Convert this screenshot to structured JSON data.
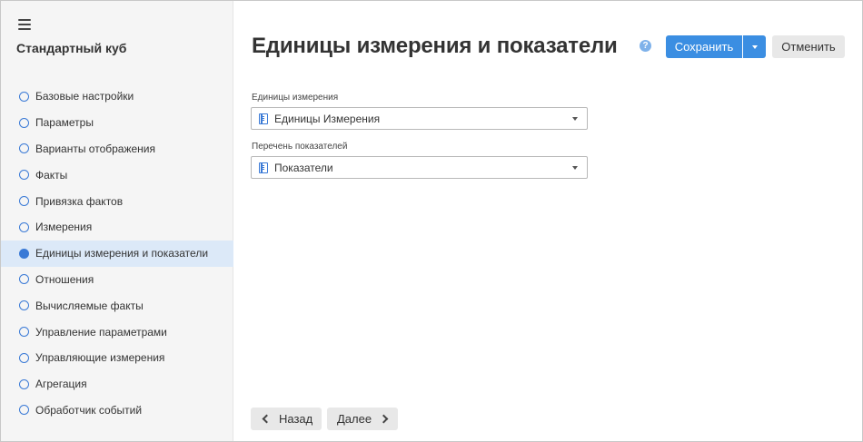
{
  "sidebar": {
    "title": "Стандартный куб",
    "steps": [
      {
        "label": "Базовые настройки",
        "active": false
      },
      {
        "label": "Параметры",
        "active": false
      },
      {
        "label": "Варианты отображения",
        "active": false
      },
      {
        "label": "Факты",
        "active": false
      },
      {
        "label": "Привязка фактов",
        "active": false
      },
      {
        "label": "Измерения",
        "active": false
      },
      {
        "label": "Единицы измерения и показатели",
        "active": true
      },
      {
        "label": "Отношения",
        "active": false
      },
      {
        "label": "Вычисляемые факты",
        "active": false
      },
      {
        "label": "Управление параметрами",
        "active": false
      },
      {
        "label": "Управляющие измерения",
        "active": false
      },
      {
        "label": "Агрегация",
        "active": false
      },
      {
        "label": "Обработчик событий",
        "active": false
      }
    ]
  },
  "header": {
    "title": "Единицы измерения и показатели",
    "help_glyph": "?",
    "save_label": "Сохранить",
    "cancel_label": "Отменить"
  },
  "form": {
    "units": {
      "label": "Единицы измерения",
      "value": "Единицы Измерения"
    },
    "indicators": {
      "label": "Перечень показателей",
      "value": "Показатели"
    }
  },
  "footer": {
    "back_label": "Назад",
    "next_label": "Далее"
  },
  "colors": {
    "accent": "#3b8ee2",
    "active_step_bg": "#dce9f8",
    "sidebar_bg": "#f5f5f5"
  },
  "icons": {
    "menu": "hamburger-icon",
    "help": "help-icon",
    "step": "radio-icon",
    "dictionary": "dictionary-icon",
    "dropdown": "chevron-down-icon",
    "back": "chevron-left-icon",
    "next": "chevron-right-icon"
  }
}
